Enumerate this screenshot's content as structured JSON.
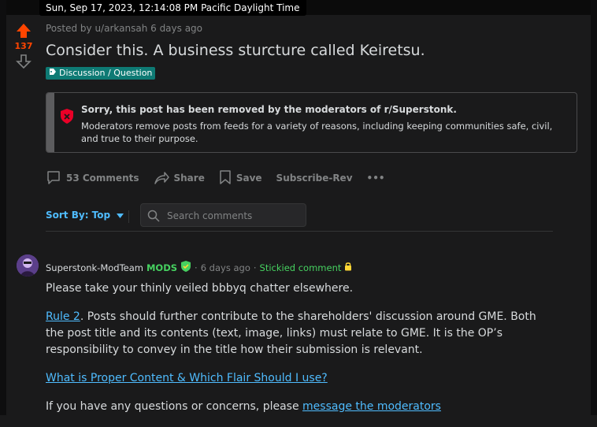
{
  "timestamp": "Sun, Sep 17, 2023, 12:14:08 PM Pacific Daylight Time",
  "post": {
    "score": "137",
    "meta": "Posted by u/arkansah 6 days ago",
    "title": "Consider this. A business sturcture called Keiretsu.",
    "flair": "Discussion / Question"
  },
  "removed_notice": {
    "title": "Sorry, this post has been removed by the moderators of r/Superstonk.",
    "body": "Moderators remove posts from feeds for a variety of reasons, including keeping communities safe, civil, and true to their purpose."
  },
  "actions": {
    "comments": "53 Comments",
    "share": "Share",
    "save": "Save",
    "subscribe": "Subscribe-Rev",
    "more": "•••"
  },
  "sort": {
    "label": "Sort By: Top"
  },
  "search": {
    "placeholder": "Search comments",
    "value": ""
  },
  "comment": {
    "user": "Superstonk-ModTeam",
    "badge": "MODS",
    "sep": "·",
    "time": "6 days ago",
    "stickied": "Stickied comment",
    "p1": "Please take your thinly veiled bbbyq chatter elsewhere.",
    "rule_link": "Rule 2",
    "p2_rest": ". Posts should further contribute to the shareholders' discussion around GME. Both the post title and its contents (text, image, links) must relate to GME. It is the OP’s responsibility to convey in the title how their submission is relevant.",
    "p3_link": "What is Proper Content & Which Flair Should I use?",
    "p4_text": "If you have any questions or concerns, please ",
    "p4_link": "message the moderators"
  },
  "colors": {
    "upvote": "#ff4500",
    "accent_blue": "#4fbcff",
    "mod_green": "#46d160",
    "flair_bg": "#0e7a74",
    "background": "#1a1a1b"
  },
  "icons": [
    "upvote-arrow-icon",
    "downvote-arrow-icon",
    "tag-icon",
    "shield-x-icon",
    "comment-icon",
    "share-icon",
    "bookmark-icon",
    "caret-down-icon",
    "search-icon",
    "mod-shield-icon",
    "lock-icon"
  ]
}
